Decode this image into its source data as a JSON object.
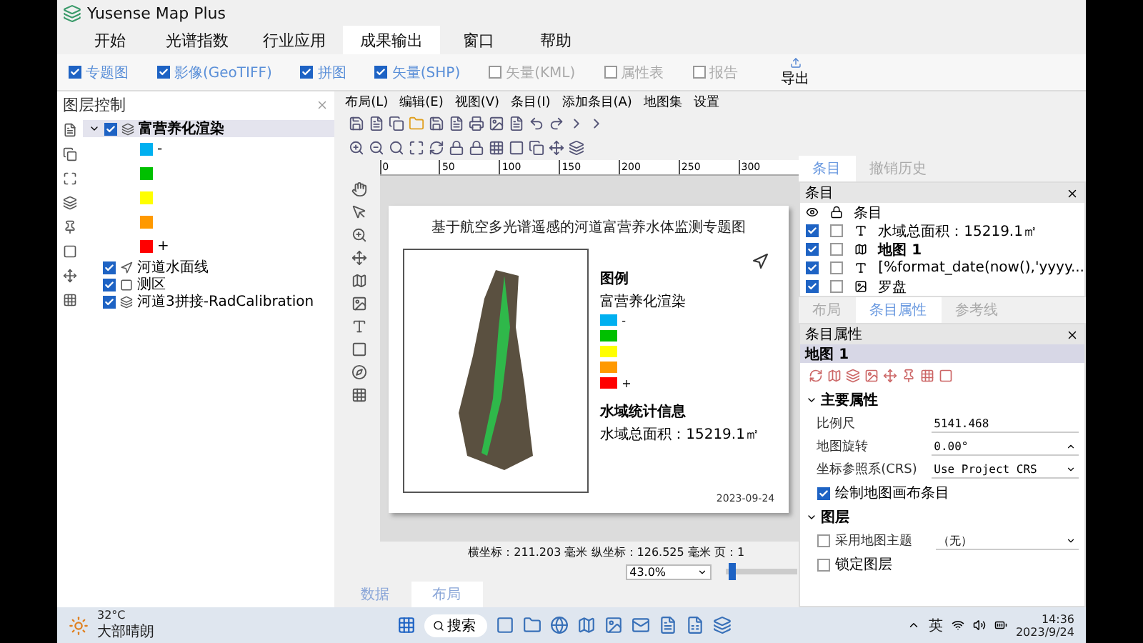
{
  "window": {
    "title": "Yusense Map Plus"
  },
  "menu_tabs": [
    {
      "label": "开始",
      "selected": false
    },
    {
      "label": "光谱指数",
      "selected": false
    },
    {
      "label": "行业应用",
      "selected": false
    },
    {
      "label": "成果输出",
      "selected": true
    },
    {
      "label": "窗口",
      "selected": false
    },
    {
      "label": "帮助",
      "selected": false
    }
  ],
  "ribbon": {
    "items": [
      {
        "label": "专题图",
        "checked": true,
        "disabled": false
      },
      {
        "label": "影像(GeoTIFF)",
        "checked": true,
        "disabled": false
      },
      {
        "label": "拼图",
        "checked": true,
        "disabled": false
      },
      {
        "label": "矢量(SHP)",
        "checked": true,
        "disabled": false
      },
      {
        "label": "矢量(KML)",
        "checked": false,
        "disabled": true
      },
      {
        "label": "属性表",
        "checked": false,
        "disabled": true
      },
      {
        "label": "报告",
        "checked": false,
        "disabled": true
      }
    ],
    "export": "导出"
  },
  "layer_panel": {
    "title": "图层控制",
    "layers": [
      {
        "name": "富营养化渲染",
        "kind": "raster",
        "checked": true,
        "expanded": true,
        "selected": true,
        "children": [
          {
            "label": "-",
            "color": "#00b0f0"
          },
          {
            "color": "#00c000"
          },
          {
            "color": "#ffff00"
          },
          {
            "color": "#ff9900"
          },
          {
            "label": "+",
            "color": "#ff0000"
          }
        ]
      },
      {
        "name": "河道水面线",
        "kind": "line",
        "checked": true,
        "selected": false
      },
      {
        "name": "测区",
        "kind": "polygon",
        "checked": true,
        "selected": false
      },
      {
        "name": "河道3拼接-RadCalibration",
        "kind": "raster",
        "checked": true,
        "selected": false
      }
    ]
  },
  "layout_editor": {
    "menu": [
      "布局(L)",
      "编辑(E)",
      "视图(V)",
      "条目(I)",
      "添加条目(A)",
      "地图集",
      "设置"
    ],
    "ruler_marks": [
      "0",
      "50",
      "100",
      "150",
      "200",
      "250",
      "300"
    ],
    "page": {
      "title": "基于航空多光谱遥感的河道富营养水体监测专题图",
      "legend_title": "图例",
      "legend_layer": "富营养化渲染",
      "legend_items": [
        {
          "label": "-",
          "color": "#00b0f0"
        },
        {
          "color": "#00c000"
        },
        {
          "color": "#ffff00"
        },
        {
          "color": "#ff9900"
        },
        {
          "label": "+",
          "color": "#ff0000"
        }
      ],
      "stats_title": "水域统计信息",
      "stats_text": "水域总面积：15219.1㎡",
      "date": "2023-09-24"
    },
    "status": "横坐标：211.203 毫米 纵坐标：126.525 毫米 页：1",
    "zoom": "43.0%",
    "zoom_slider": {
      "level": 0.04
    },
    "bottom_tabs": [
      {
        "label": "数据",
        "selected": false
      },
      {
        "label": "布局",
        "selected": true
      }
    ]
  },
  "items_panel": {
    "tabs": [
      {
        "label": "条目",
        "selected": true
      },
      {
        "label": "撤销历史",
        "selected": false
      }
    ],
    "title": "条目",
    "column": "条目",
    "rows": [
      {
        "label": "水域总面积：15219.1㎡",
        "kind": "text",
        "visible": true,
        "locked": false,
        "selected": false
      },
      {
        "label": "地图 1",
        "kind": "map",
        "visible": true,
        "locked": false,
        "selected": true
      },
      {
        "label": "[%format_date(now(),'yyyy...",
        "kind": "text",
        "visible": true,
        "locked": false,
        "selected": false
      },
      {
        "label": "罗盘",
        "kind": "picture",
        "visible": true,
        "locked": false,
        "selected": false
      }
    ]
  },
  "properties_panel": {
    "tabs": [
      {
        "label": "布局",
        "selected": false
      },
      {
        "label": "条目属性",
        "selected": true
      },
      {
        "label": "参考线",
        "selected": false
      }
    ],
    "title": "条目属性",
    "item_name": "地图 1",
    "sections": [
      {
        "title": "主要属性",
        "expanded": true,
        "fields": [
          {
            "kind": "input",
            "label": "比例尺",
            "value": "5141.468"
          },
          {
            "kind": "spin",
            "label": "地图旋转",
            "value": "0.00°"
          },
          {
            "kind": "select",
            "label": "坐标参照系(CRS)",
            "value": "Use Project CRS"
          },
          {
            "kind": "checkbox",
            "label": "绘制地图画布条目",
            "checked": true
          }
        ]
      },
      {
        "title": "图层",
        "expanded": true,
        "fields": [
          {
            "kind": "checkbox_select",
            "label": "采用地图主题",
            "checked": false,
            "value": "（无）"
          },
          {
            "kind": "checkbox",
            "label": "锁定图层",
            "checked": false
          }
        ]
      }
    ]
  },
  "taskbar": {
    "temperature": "32°C",
    "weather": "大部晴朗",
    "search": "搜索",
    "language": "英",
    "time": "14:36",
    "date": "2023/9/24"
  }
}
